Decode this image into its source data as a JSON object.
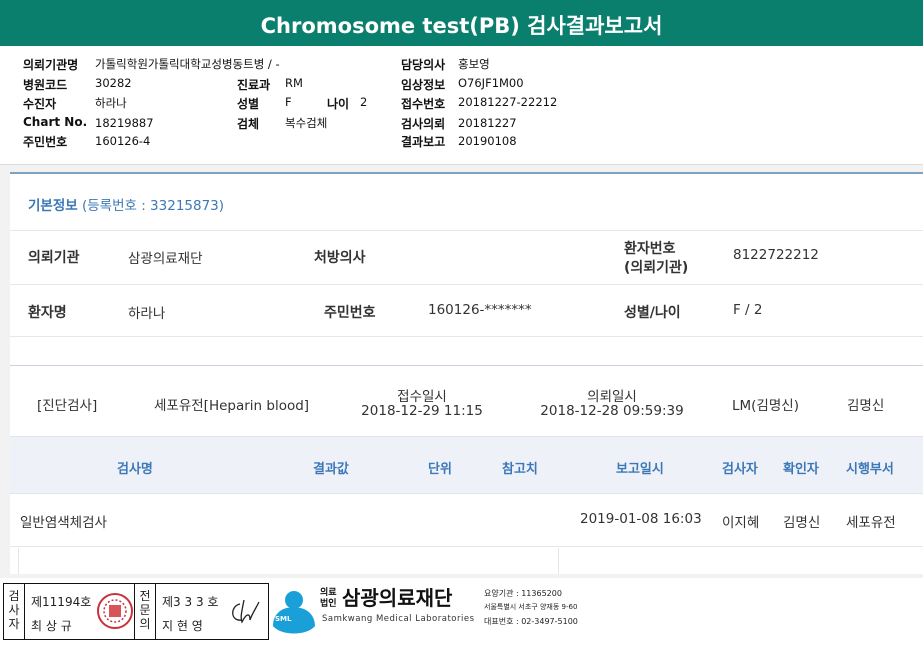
{
  "title": "Chromosome test(PB) 검사결과보고서",
  "header": {
    "referring_org_label": "의뢰기관명",
    "referring_org": "가톨릭학원가톨릭대학교성병동트병 / -",
    "hospital_code_label": "병원코드",
    "hospital_code": "30282",
    "receiver_label": "수진자",
    "receiver": "하라나",
    "chart_no_label": "Chart No.",
    "chart_no": "18219887",
    "resident_no_label": "주민번호",
    "resident_no": "160126-4",
    "dept_label": "진료과",
    "dept": "RM",
    "sex_label": "성별",
    "sex": "F",
    "age_label": "나이",
    "age": "2",
    "specimen_label": "검체",
    "specimen": "복수검체",
    "doctor_label": "담당의사",
    "doctor": "홍보영",
    "clinical_label": "임상정보",
    "clinical": "O76JF1M00",
    "accession_label": "접수번호",
    "accession": "20181227-22212",
    "request_label": "검사의뢰",
    "request_date": "20181227",
    "report_label": "결과보고",
    "report_date": "20190108"
  },
  "basic": {
    "heading": "기본정보",
    "reg_no": "(등록번호 : 33215873)",
    "org_label": "의뢰기관",
    "org": "삼광의료재단",
    "prescriber_label": "처방의사",
    "pid_label_1": "환자번호",
    "pid_label_2": "(의뢰기관)",
    "pid": "8122722212",
    "name_label": "환자명",
    "name": "하라나",
    "resident_label": "주민번호",
    "resident": "160126-*******",
    "sexage_label": "성별/나이",
    "sexage": "F / 2"
  },
  "order": {
    "category": "[진단검사]",
    "test": "세포유전[Heparin blood]",
    "received_label": "접수일시",
    "received": "2018-12-29 11:15",
    "requested_label": "의뢰일시",
    "requested": "2018-12-28 09:59:39",
    "lm": "LM(김명신)",
    "doctor": "김명신"
  },
  "table": {
    "headers": [
      "검사명",
      "결과값",
      "단위",
      "참고치",
      "보고일시",
      "검사자",
      "확인자",
      "시행부서"
    ],
    "rows": [
      {
        "name": "일반염색체검사",
        "result": "",
        "unit": "",
        "ref": "",
        "date": "2019-01-08 16:03",
        "tester": "이지혜",
        "checker": "김명신",
        "dept": "세포유전"
      }
    ]
  },
  "footer": {
    "tester_side": "검사자",
    "tester_no": "제11194호",
    "tester_name": "최 상 규",
    "spec_side": "전문의",
    "spec_no": "제3 3 3 호",
    "spec_name": "지 현 영",
    "corp_label": "의료법인",
    "org_name": "삼광의료재단",
    "org_en": "Samkwang Medical Laboratories",
    "logo_text": "SML",
    "code_line": "요양기관 : 11365200",
    "addr_line": "서울특별시 서초구 양재동 9-60",
    "tel_line": "대표번호 : 02-3497-5100"
  },
  "colors": {
    "brand": "#0b7f6e",
    "accent": "#3c78b8",
    "logo": "#1aa0d8"
  }
}
